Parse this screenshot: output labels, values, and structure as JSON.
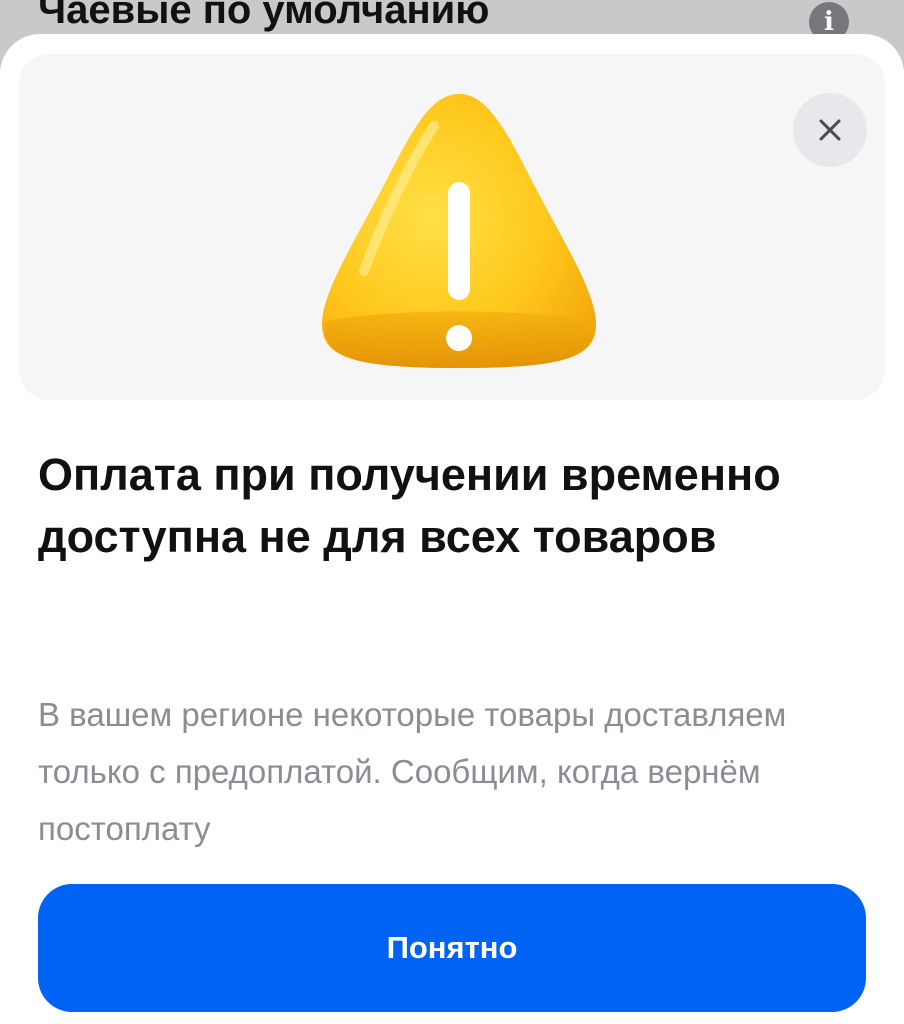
{
  "background_screen": {
    "title": "Чаевые по умолчанию",
    "info_icon": "info-icon"
  },
  "dialog": {
    "illustration": "warning-triangle-icon",
    "close_icon": "close-icon",
    "title": "Оплата при получении временно доступна не для всех товаров",
    "description": "В вашем регионе некоторые товары доставляем только с предоплатой. Сообщим, когда вернём постоплату",
    "primary_button_label": "Понятно"
  },
  "colors": {
    "primary_button": "#0063f4",
    "warning_yellow": "#ffc61a",
    "description_text": "#8b8d94"
  }
}
